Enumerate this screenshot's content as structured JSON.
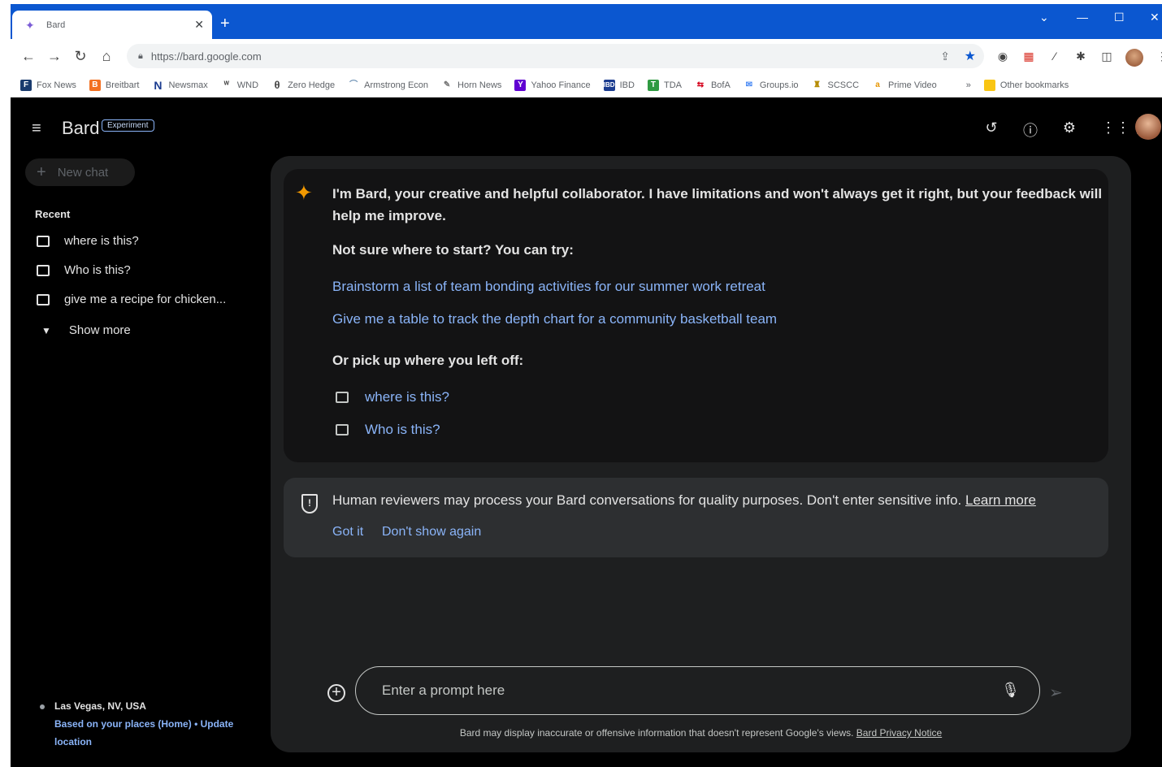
{
  "browser": {
    "tab": {
      "title": "Bard",
      "favicon": "bard-sparkle-icon"
    },
    "url": "https://bard.google.com",
    "bookmarks": [
      {
        "label": "Fox News",
        "icon": "fox-news-icon",
        "color": "#1a3b6e"
      },
      {
        "label": "Breitbart",
        "icon": "breitbart-icon",
        "color": "#f37021"
      },
      {
        "label": "Newsmax",
        "icon": "newsmax-icon",
        "color": "#1a3b8f"
      },
      {
        "label": "WND",
        "icon": "wnd-icon",
        "color": "#333333"
      },
      {
        "label": "Zero Hedge",
        "icon": "zero-hedge-icon",
        "color": "#444444"
      },
      {
        "label": "Armstrong Econ",
        "icon": "armstrong-icon",
        "color": "#6a8fb3"
      },
      {
        "label": "Horn News",
        "icon": "horn-news-icon",
        "color": "#777777"
      },
      {
        "label": "Yahoo Finance",
        "icon": "yahoo-icon",
        "color": "#6001d2"
      },
      {
        "label": "IBD",
        "icon": "ibd-icon",
        "color": "#1a3b8f"
      },
      {
        "label": "TDA",
        "icon": "tda-icon",
        "color": "#2f9a41"
      },
      {
        "label": "BofA",
        "icon": "bofa-icon",
        "color": "#d4001a"
      },
      {
        "label": "Groups.io",
        "icon": "groups-icon",
        "color": "#4285f4"
      },
      {
        "label": "SCSCC",
        "icon": "scscc-icon",
        "color": "#b58b00"
      },
      {
        "label": "Prime Video",
        "icon": "prime-video-icon",
        "color": "#e69500"
      }
    ],
    "bookmarks_overflow": "»",
    "other_bookmarks": "Other bookmarks"
  },
  "header": {
    "logo": "Bard",
    "badge": "Experiment"
  },
  "sidebar": {
    "new_chat": "New chat",
    "recent_label": "Recent",
    "recent": [
      {
        "label": "where is this?"
      },
      {
        "label": "Who is this?"
      },
      {
        "label": "give me a recipe for chicken..."
      }
    ],
    "show_more": "Show more",
    "location": {
      "city": "Las Vegas, NV, USA",
      "based_on": "Based on your places (Home)",
      "separator": "•",
      "update": "Update location"
    }
  },
  "welcome": {
    "intro": "I'm Bard, your creative and helpful collaborator. I have limitations and won't always get it right, but your feedback will help me improve.",
    "try_label": "Not sure where to start? You can try:",
    "suggestions": [
      "Brainstorm a list of team bonding activities for our summer work retreat",
      "Give me a table to track the depth chart for a community basketball team"
    ],
    "pickup_label": "Or pick up where you left off:",
    "pickup": [
      "where is this?",
      "Who is this?"
    ]
  },
  "notice": {
    "text": "Human reviewers may process your Bard conversations for quality purposes. Don't enter sensitive info.",
    "link": "Learn more",
    "got_it": "Got it",
    "dont_show": "Don't show again"
  },
  "composer": {
    "placeholder": "Enter a prompt here",
    "disclaimer": "Bard may display inaccurate or offensive information that doesn't represent Google's views.",
    "privacy_link": "Bard Privacy Notice"
  }
}
